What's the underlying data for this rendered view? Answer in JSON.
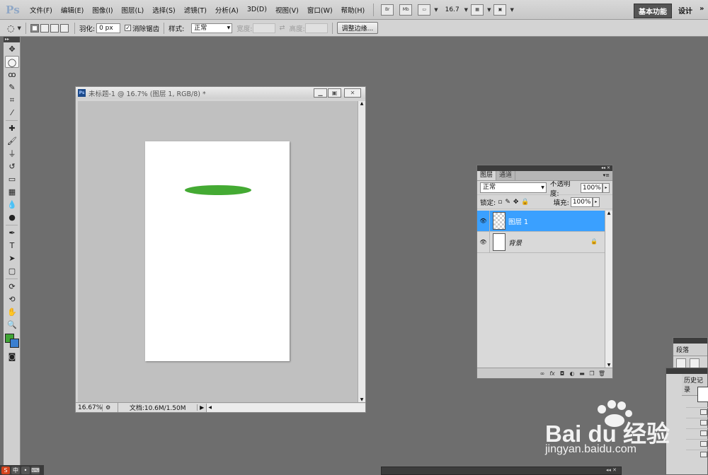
{
  "app": {
    "logo": "Ps",
    "menus": [
      "文件(F)",
      "编辑(E)",
      "图像(I)",
      "图层(L)",
      "选择(S)",
      "滤镜(T)",
      "分析(A)",
      "3D(D)",
      "视图(V)",
      "窗口(W)",
      "帮助(H)"
    ],
    "bridge_btn": "Br",
    "minibridge_btn": "Mb",
    "zoom": "16.7",
    "workspaces": {
      "active": "基本功能",
      "design": "设计",
      "more": "»"
    }
  },
  "options": {
    "feather_label": "羽化:",
    "feather_value": "0 px",
    "antialias_label": "消除锯齿",
    "antialias_checked": "✓",
    "style_label": "样式:",
    "style_value": "正常",
    "width_label": "宽度:",
    "height_label": "高度:",
    "refine_edge": "调整边缘..."
  },
  "toolbox": {
    "tools": [
      {
        "name": "move-tool-icon",
        "glyph": "✥"
      },
      {
        "name": "elliptical-marquee-tool-icon",
        "glyph": "◯",
        "active": true
      },
      {
        "name": "lasso-tool-icon",
        "glyph": "ꝏ"
      },
      {
        "name": "quick-selection-tool-icon",
        "glyph": "✎"
      },
      {
        "name": "crop-tool-icon",
        "glyph": "⌗"
      },
      {
        "name": "eyedropper-tool-icon",
        "glyph": "⁄"
      },
      {
        "name": "spot-healing-tool-icon",
        "glyph": "✚"
      },
      {
        "name": "brush-tool-icon",
        "glyph": "🖌"
      },
      {
        "name": "clone-stamp-tool-icon",
        "glyph": "⏚"
      },
      {
        "name": "history-brush-tool-icon",
        "glyph": "↺"
      },
      {
        "name": "eraser-tool-icon",
        "glyph": "▭"
      },
      {
        "name": "gradient-tool-icon",
        "glyph": "▦"
      },
      {
        "name": "blur-tool-icon",
        "glyph": "💧"
      },
      {
        "name": "dodge-tool-icon",
        "glyph": "●"
      },
      {
        "name": "pen-tool-icon",
        "glyph": "✒"
      },
      {
        "name": "type-tool-icon",
        "glyph": "T"
      },
      {
        "name": "path-selection-tool-icon",
        "glyph": "➤"
      },
      {
        "name": "rectangle-tool-icon",
        "glyph": "▢"
      },
      {
        "name": "3d-rotate-tool-icon",
        "glyph": "⟳"
      },
      {
        "name": "3d-orbit-tool-icon",
        "glyph": "⟲"
      },
      {
        "name": "hand-tool-icon",
        "glyph": "✋"
      },
      {
        "name": "zoom-tool-icon",
        "glyph": "🔍"
      }
    ],
    "fg_color": "#3fa535",
    "bg_color": "#3a7fd0"
  },
  "document": {
    "title": "未标题-1 @ 16.7% (图层 1, RGB/8) *",
    "zoom": "16.67%",
    "doc_info": "文档:10.6M/1.50M",
    "ellipse_color": "#44aa33"
  },
  "layers": {
    "tabs": [
      "图层",
      "通道"
    ],
    "blend_mode": "正常",
    "opacity_label": "不透明度:",
    "opacity_value": "100%",
    "lock_label": "锁定:",
    "fill_label": "填充:",
    "fill_value": "100%",
    "items": [
      {
        "name": "图层 1",
        "selected": true
      },
      {
        "name": "背景",
        "selected": false,
        "locked": true
      }
    ]
  },
  "side_panels": {
    "paragraph_tab": "段落",
    "history_tab": "历史记录"
  },
  "watermark": {
    "brand": "Bai du 经验",
    "url": "jingyan.baidu.com"
  }
}
